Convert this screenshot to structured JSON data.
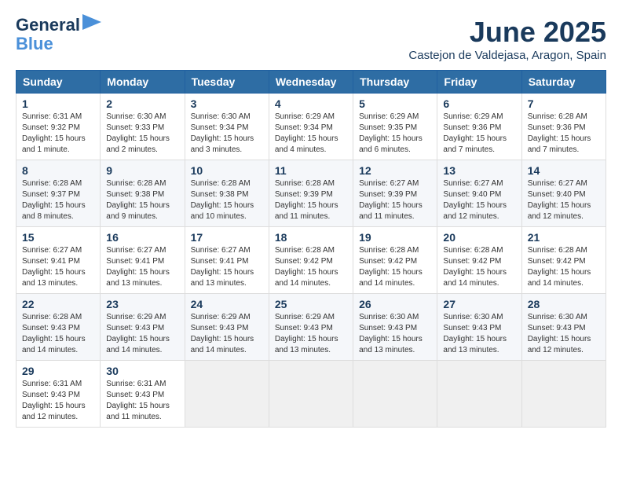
{
  "logo": {
    "line1": "General",
    "line2": "Blue"
  },
  "title": "June 2025",
  "location": "Castejon de Valdejasa, Aragon, Spain",
  "days_of_week": [
    "Sunday",
    "Monday",
    "Tuesday",
    "Wednesday",
    "Thursday",
    "Friday",
    "Saturday"
  ],
  "weeks": [
    [
      {
        "day": "1",
        "lines": [
          "Sunrise: 6:31 AM",
          "Sunset: 9:32 PM",
          "Daylight: 15 hours",
          "and 1 minute."
        ]
      },
      {
        "day": "2",
        "lines": [
          "Sunrise: 6:30 AM",
          "Sunset: 9:33 PM",
          "Daylight: 15 hours",
          "and 2 minutes."
        ]
      },
      {
        "day": "3",
        "lines": [
          "Sunrise: 6:30 AM",
          "Sunset: 9:34 PM",
          "Daylight: 15 hours",
          "and 3 minutes."
        ]
      },
      {
        "day": "4",
        "lines": [
          "Sunrise: 6:29 AM",
          "Sunset: 9:34 PM",
          "Daylight: 15 hours",
          "and 4 minutes."
        ]
      },
      {
        "day": "5",
        "lines": [
          "Sunrise: 6:29 AM",
          "Sunset: 9:35 PM",
          "Daylight: 15 hours",
          "and 6 minutes."
        ]
      },
      {
        "day": "6",
        "lines": [
          "Sunrise: 6:29 AM",
          "Sunset: 9:36 PM",
          "Daylight: 15 hours",
          "and 7 minutes."
        ]
      },
      {
        "day": "7",
        "lines": [
          "Sunrise: 6:28 AM",
          "Sunset: 9:36 PM",
          "Daylight: 15 hours",
          "and 7 minutes."
        ]
      }
    ],
    [
      {
        "day": "8",
        "lines": [
          "Sunrise: 6:28 AM",
          "Sunset: 9:37 PM",
          "Daylight: 15 hours",
          "and 8 minutes."
        ]
      },
      {
        "day": "9",
        "lines": [
          "Sunrise: 6:28 AM",
          "Sunset: 9:38 PM",
          "Daylight: 15 hours",
          "and 9 minutes."
        ]
      },
      {
        "day": "10",
        "lines": [
          "Sunrise: 6:28 AM",
          "Sunset: 9:38 PM",
          "Daylight: 15 hours",
          "and 10 minutes."
        ]
      },
      {
        "day": "11",
        "lines": [
          "Sunrise: 6:28 AM",
          "Sunset: 9:39 PM",
          "Daylight: 15 hours",
          "and 11 minutes."
        ]
      },
      {
        "day": "12",
        "lines": [
          "Sunrise: 6:27 AM",
          "Sunset: 9:39 PM",
          "Daylight: 15 hours",
          "and 11 minutes."
        ]
      },
      {
        "day": "13",
        "lines": [
          "Sunrise: 6:27 AM",
          "Sunset: 9:40 PM",
          "Daylight: 15 hours",
          "and 12 minutes."
        ]
      },
      {
        "day": "14",
        "lines": [
          "Sunrise: 6:27 AM",
          "Sunset: 9:40 PM",
          "Daylight: 15 hours",
          "and 12 minutes."
        ]
      }
    ],
    [
      {
        "day": "15",
        "lines": [
          "Sunrise: 6:27 AM",
          "Sunset: 9:41 PM",
          "Daylight: 15 hours",
          "and 13 minutes."
        ]
      },
      {
        "day": "16",
        "lines": [
          "Sunrise: 6:27 AM",
          "Sunset: 9:41 PM",
          "Daylight: 15 hours",
          "and 13 minutes."
        ]
      },
      {
        "day": "17",
        "lines": [
          "Sunrise: 6:27 AM",
          "Sunset: 9:41 PM",
          "Daylight: 15 hours",
          "and 13 minutes."
        ]
      },
      {
        "day": "18",
        "lines": [
          "Sunrise: 6:28 AM",
          "Sunset: 9:42 PM",
          "Daylight: 15 hours",
          "and 14 minutes."
        ]
      },
      {
        "day": "19",
        "lines": [
          "Sunrise: 6:28 AM",
          "Sunset: 9:42 PM",
          "Daylight: 15 hours",
          "and 14 minutes."
        ]
      },
      {
        "day": "20",
        "lines": [
          "Sunrise: 6:28 AM",
          "Sunset: 9:42 PM",
          "Daylight: 15 hours",
          "and 14 minutes."
        ]
      },
      {
        "day": "21",
        "lines": [
          "Sunrise: 6:28 AM",
          "Sunset: 9:42 PM",
          "Daylight: 15 hours",
          "and 14 minutes."
        ]
      }
    ],
    [
      {
        "day": "22",
        "lines": [
          "Sunrise: 6:28 AM",
          "Sunset: 9:43 PM",
          "Daylight: 15 hours",
          "and 14 minutes."
        ]
      },
      {
        "day": "23",
        "lines": [
          "Sunrise: 6:29 AM",
          "Sunset: 9:43 PM",
          "Daylight: 15 hours",
          "and 14 minutes."
        ]
      },
      {
        "day": "24",
        "lines": [
          "Sunrise: 6:29 AM",
          "Sunset: 9:43 PM",
          "Daylight: 15 hours",
          "and 14 minutes."
        ]
      },
      {
        "day": "25",
        "lines": [
          "Sunrise: 6:29 AM",
          "Sunset: 9:43 PM",
          "Daylight: 15 hours",
          "and 13 minutes."
        ]
      },
      {
        "day": "26",
        "lines": [
          "Sunrise: 6:30 AM",
          "Sunset: 9:43 PM",
          "Daylight: 15 hours",
          "and 13 minutes."
        ]
      },
      {
        "day": "27",
        "lines": [
          "Sunrise: 6:30 AM",
          "Sunset: 9:43 PM",
          "Daylight: 15 hours",
          "and 13 minutes."
        ]
      },
      {
        "day": "28",
        "lines": [
          "Sunrise: 6:30 AM",
          "Sunset: 9:43 PM",
          "Daylight: 15 hours",
          "and 12 minutes."
        ]
      }
    ],
    [
      {
        "day": "29",
        "lines": [
          "Sunrise: 6:31 AM",
          "Sunset: 9:43 PM",
          "Daylight: 15 hours",
          "and 12 minutes."
        ]
      },
      {
        "day": "30",
        "lines": [
          "Sunrise: 6:31 AM",
          "Sunset: 9:43 PM",
          "Daylight: 15 hours",
          "and 11 minutes."
        ]
      },
      {
        "day": "",
        "lines": []
      },
      {
        "day": "",
        "lines": []
      },
      {
        "day": "",
        "lines": []
      },
      {
        "day": "",
        "lines": []
      },
      {
        "day": "",
        "lines": []
      }
    ]
  ]
}
